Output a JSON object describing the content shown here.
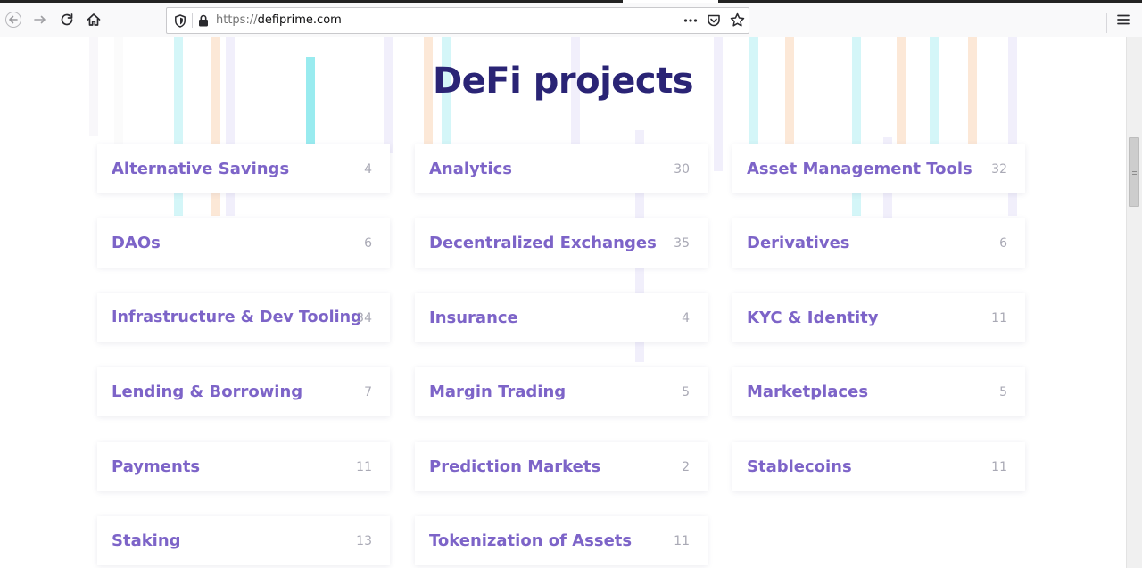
{
  "browser": {
    "url_scheme": "https://",
    "url_host": "defiprime.com",
    "icons": [
      "back-icon",
      "forward-icon",
      "reload-icon",
      "home-icon",
      "shield-icon",
      "lock-icon",
      "more-icon",
      "pocket-icon",
      "star-icon",
      "menu-icon"
    ]
  },
  "page": {
    "title": "DeFi projects"
  },
  "categories": [
    {
      "name": "Alternative Savings",
      "count": "4"
    },
    {
      "name": "Analytics",
      "count": "30"
    },
    {
      "name": "Asset Management Tools",
      "count": "32"
    },
    {
      "name": "DAOs",
      "count": "6"
    },
    {
      "name": "Decentralized Exchanges",
      "count": "35"
    },
    {
      "name": "Derivatives",
      "count": "6"
    },
    {
      "name": "Infrastructure & Dev Tooling",
      "count": "34"
    },
    {
      "name": "Insurance",
      "count": "4"
    },
    {
      "name": "KYC & Identity",
      "count": "11"
    },
    {
      "name": "Lending & Borrowing",
      "count": "7"
    },
    {
      "name": "Margin Trading",
      "count": "5"
    },
    {
      "name": "Marketplaces",
      "count": "5"
    },
    {
      "name": "Payments",
      "count": "11"
    },
    {
      "name": "Prediction Markets",
      "count": "2"
    },
    {
      "name": "Stablecoins",
      "count": "11"
    },
    {
      "name": "Staking",
      "count": "13"
    },
    {
      "name": "Tokenization of Assets",
      "count": "11"
    }
  ],
  "colors": {
    "title": "#2a2475",
    "category_name": "#7d64c8",
    "category_count": "#a9a9b5"
  }
}
